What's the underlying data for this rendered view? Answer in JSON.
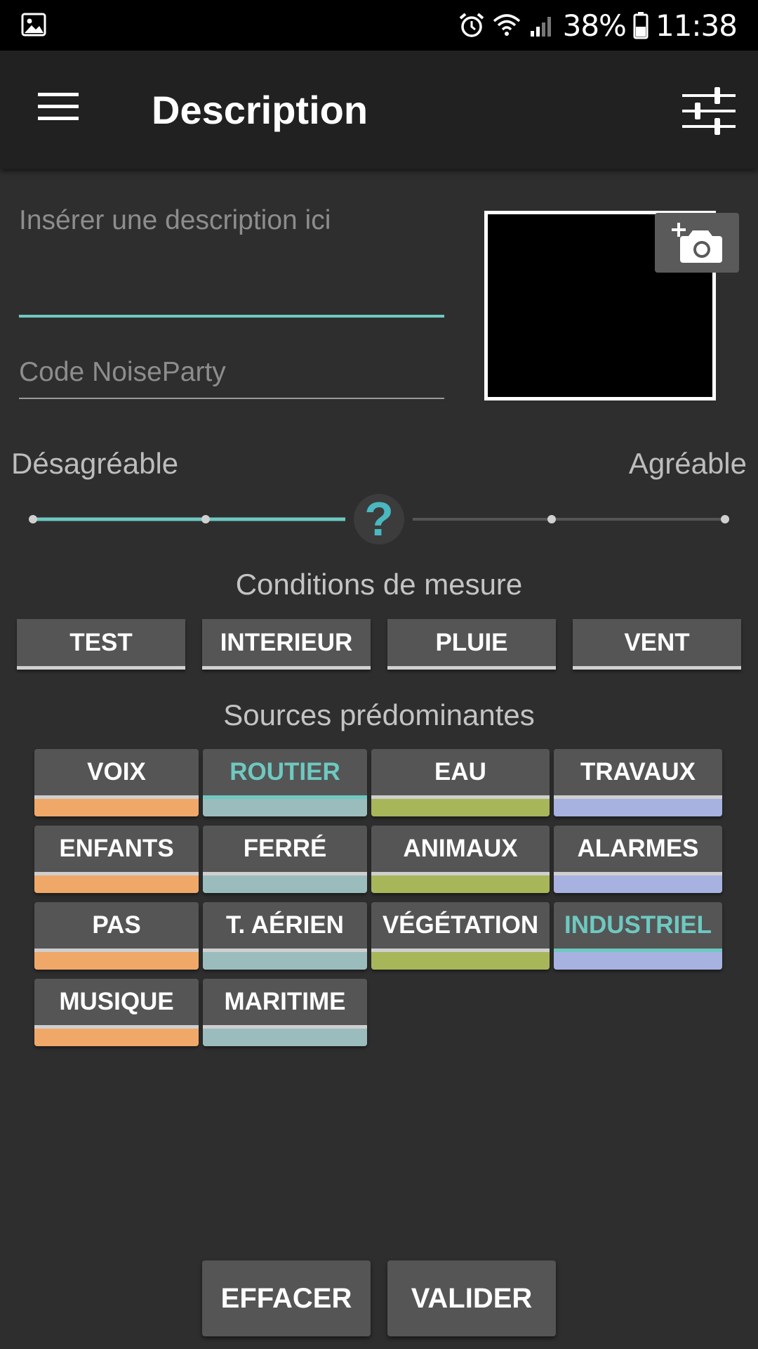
{
  "status_bar": {
    "battery": "38%",
    "time": "11:38",
    "icons": [
      "image-icon",
      "alarm-icon",
      "wifi-icon",
      "signal-icon",
      "battery-icon"
    ]
  },
  "app_bar": {
    "title": "Description",
    "menu_icon": "hamburger-menu-icon",
    "settings_icon": "sliders-icon"
  },
  "form": {
    "description_placeholder": "Insérer une description ici",
    "description_value": "",
    "code_placeholder": "Code NoiseParty",
    "code_value": "",
    "photo_button_icon": "add-photo-icon"
  },
  "pleasantness": {
    "label_left": "Désagréable",
    "label_right": "Agréable",
    "steps": 5,
    "current_value": "?",
    "accent": "#6ec9c1"
  },
  "conditions": {
    "title": "Conditions de mesure",
    "buttons": [
      "TEST",
      "INTERIEUR",
      "PLUIE",
      "VENT"
    ]
  },
  "sources": {
    "title": "Sources prédominantes",
    "items": [
      {
        "label": "VOIX",
        "color": "#f0a868",
        "selected": false
      },
      {
        "label": "ROUTIER",
        "color": "#9bbcbc",
        "selected": true
      },
      {
        "label": "EAU",
        "color": "#a8b65a",
        "selected": false
      },
      {
        "label": "TRAVAUX",
        "color": "#a7b2e0",
        "selected": false
      },
      {
        "label": "ENFANTS",
        "color": "#f0a868",
        "selected": false
      },
      {
        "label": "FERRÉ",
        "color": "#9bbcbc",
        "selected": false
      },
      {
        "label": "ANIMAUX",
        "color": "#a8b65a",
        "selected": false
      },
      {
        "label": "ALARMES",
        "color": "#a7b2e0",
        "selected": false
      },
      {
        "label": "PAS",
        "color": "#f0a868",
        "selected": false
      },
      {
        "label": "T. AÉRIEN",
        "color": "#9bbcbc",
        "selected": false
      },
      {
        "label": "VÉGÉTATION",
        "color": "#a8b65a",
        "selected": false
      },
      {
        "label": "INDUSTRIEL",
        "color": "#a7b2e0",
        "selected": true
      },
      {
        "label": "MUSIQUE",
        "color": "#f0a868",
        "selected": false
      },
      {
        "label": "MARITIME",
        "color": "#9bbcbc",
        "selected": false
      }
    ]
  },
  "actions": {
    "clear": "EFFACER",
    "validate": "VALIDER"
  }
}
